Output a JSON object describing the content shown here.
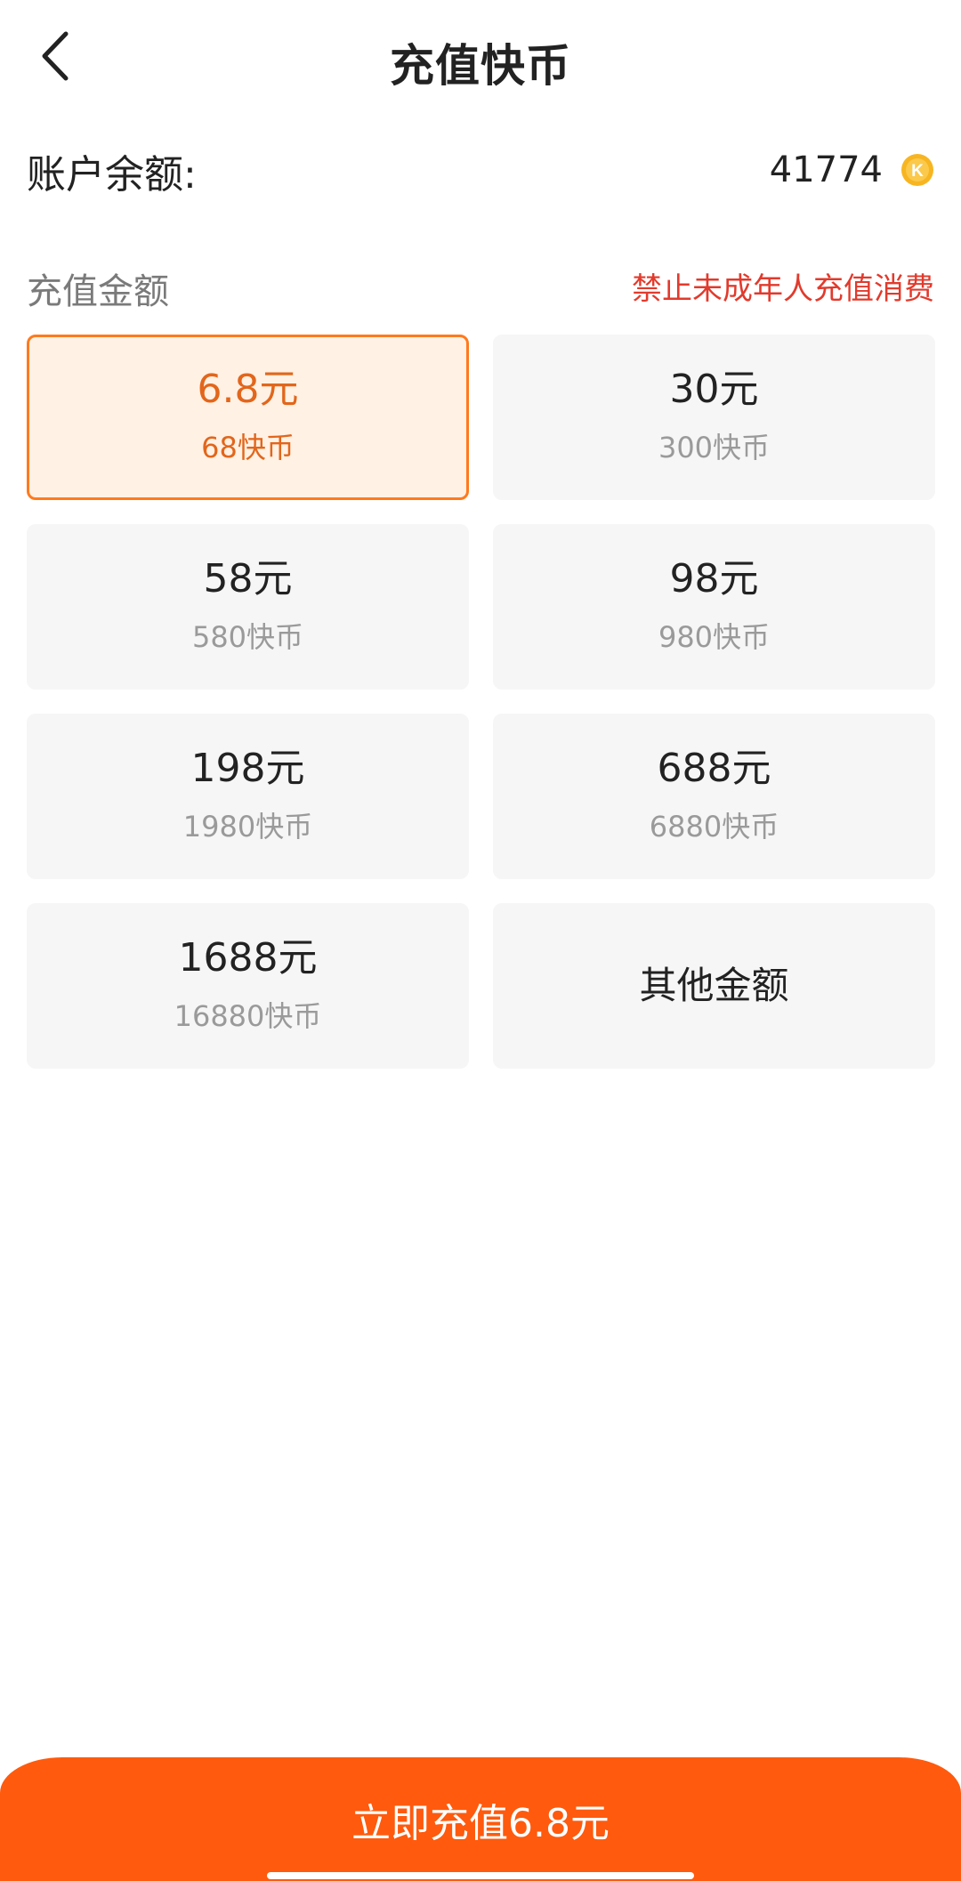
{
  "header": {
    "title": "充值快币",
    "back_icon": "chevron-left-icon"
  },
  "balance": {
    "label": "账户余额:",
    "value": "41774",
    "coin_icon": "k-coin-icon",
    "coin_letter": "K",
    "coin_color": "#f7b521"
  },
  "recharge": {
    "label": "充值金额",
    "warning": "禁止未成年人充值消费",
    "selected_index": 0,
    "options": [
      {
        "price": "6.8元",
        "coins": "68快币"
      },
      {
        "price": "30元",
        "coins": "300快币"
      },
      {
        "price": "58元",
        "coins": "580快币"
      },
      {
        "price": "98元",
        "coins": "980快币"
      },
      {
        "price": "198元",
        "coins": "1980快币"
      },
      {
        "price": "688元",
        "coins": "6880快币"
      },
      {
        "price": "1688元",
        "coins": "16880快币"
      }
    ],
    "other_label": "其他金额"
  },
  "pay_button": {
    "label": "立即充值6.8元"
  },
  "colors": {
    "accent": "#ff5a0d",
    "selected_border": "#ff7a1d",
    "selected_bg": "#fff1e4",
    "warning": "#e23a2c",
    "card_bg": "#f6f6f6"
  }
}
